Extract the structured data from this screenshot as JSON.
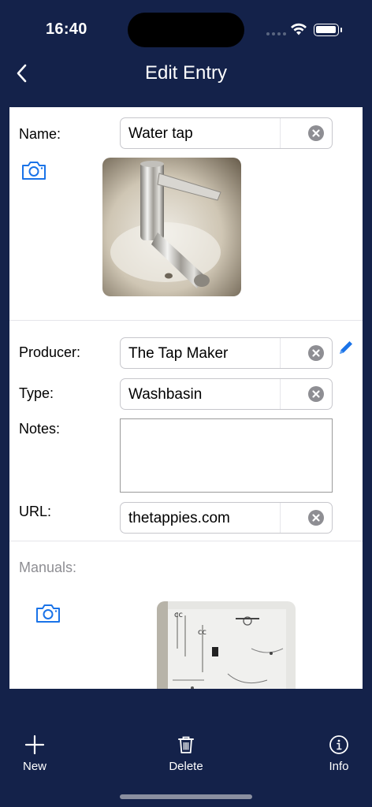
{
  "status_bar": {
    "time": "16:40"
  },
  "nav": {
    "title": "Edit Entry"
  },
  "form": {
    "name_label": "Name:",
    "name_value": "Water tap",
    "producer_label": "Producer:",
    "producer_value": "The Tap Maker",
    "type_label": "Type:",
    "type_value": "Washbasin",
    "notes_label": "Notes:",
    "notes_value": "",
    "url_label": "URL:",
    "url_value": "thetappies.com",
    "manuals_label": "Manuals:"
  },
  "toolbar": {
    "new_label": "New",
    "delete_label": "Delete",
    "info_label": "Info"
  },
  "colors": {
    "background": "#14224a",
    "accent": "#1a73e8",
    "clear_button": "#8e8e93"
  },
  "icons": [
    "back-chevron-icon",
    "camera-icon",
    "clear-icon",
    "pencil-icon",
    "plus-icon",
    "trash-icon",
    "info-icon",
    "wifi-icon",
    "battery-icon"
  ]
}
